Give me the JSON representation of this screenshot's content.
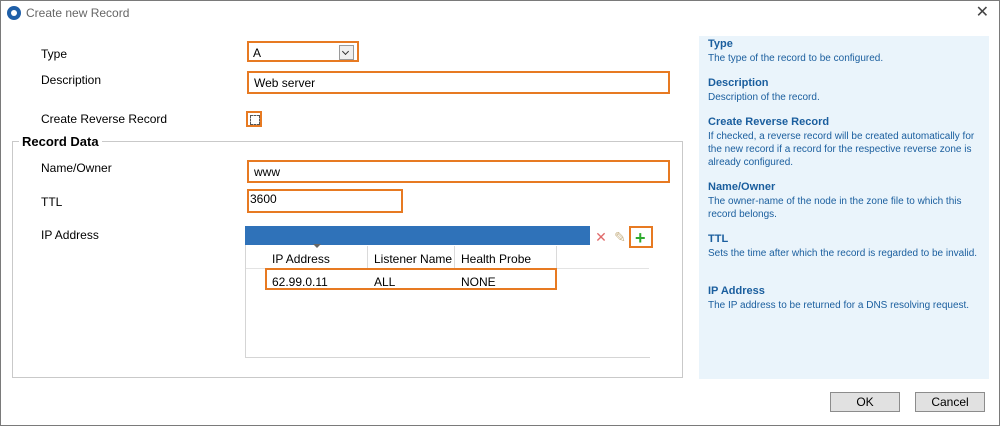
{
  "window": {
    "title": "Create new Record"
  },
  "form": {
    "type_label": "Type",
    "type_value": "A",
    "description_label": "Description",
    "description_value": "Web server",
    "reverse_label": "Create Reverse Record",
    "reverse_checked": false
  },
  "record_data": {
    "title": "Record Data",
    "name_label": "Name/Owner",
    "name_value": "www",
    "ttl_label": "TTL",
    "ttl_value": "3600",
    "ip_label": "IP Address",
    "columns": [
      "IP Address",
      "Listener Name",
      "Health Probe"
    ],
    "rows": [
      [
        "62.99.0.11",
        "ALL",
        "NONE"
      ]
    ]
  },
  "help": [
    {
      "title": "Type",
      "text": "The type of the record to be configured."
    },
    {
      "title": "Description",
      "text": "Description of the record."
    },
    {
      "title": "Create Reverse Record",
      "text": "If checked, a reverse record will be created automatically for the new record if a record for the respective reverse zone is already configured."
    },
    {
      "title": "Name/Owner",
      "text": "The owner-name of the node in the zone file to which this record belongs."
    },
    {
      "title": "TTL",
      "text": "Sets the time after which the record is regarded to be invalid."
    },
    {
      "title": "IP Address",
      "text": "The IP address to be returned for a DNS resolving request."
    }
  ],
  "buttons": {
    "ok": "OK",
    "cancel": "Cancel"
  },
  "icons": {
    "app": "app-logo-icon",
    "close": "close-icon",
    "delete": "delete-icon",
    "edit": "edit-pencil-icon",
    "add": "add-plus-icon"
  },
  "colors": {
    "highlight": "#e77a22",
    "table_header": "#2f72b9",
    "help_bg": "#eaf4fb",
    "help_text": "#1a5e9e"
  }
}
